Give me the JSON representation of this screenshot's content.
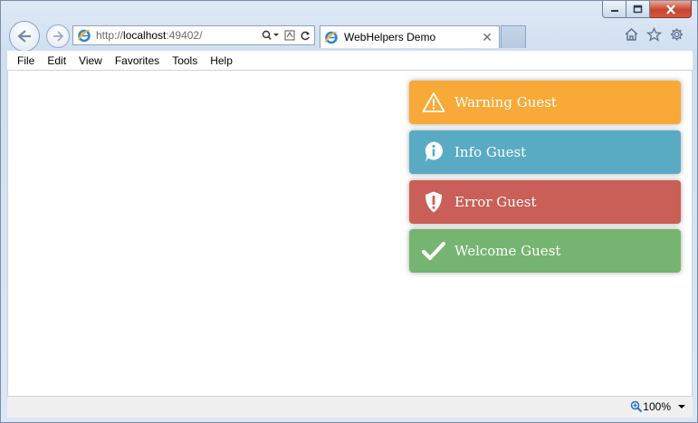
{
  "browser": {
    "url_prefix": "http://",
    "url_host": "localhost",
    "url_suffix": ":49402/",
    "tab_title": "WebHelpers Demo",
    "tab_close": "✕"
  },
  "menu": {
    "items": [
      "File",
      "Edit",
      "View",
      "Favorites",
      "Tools",
      "Help"
    ]
  },
  "toasts": [
    {
      "type": "warning",
      "text": "Warning Guest",
      "color": "#f9a938",
      "icon": "warning-triangle-icon"
    },
    {
      "type": "info",
      "text": "Info Guest",
      "color": "#59abc4",
      "icon": "info-bubble-icon"
    },
    {
      "type": "error",
      "text": "Error Guest",
      "color": "#c95f56",
      "icon": "shield-exclamation-icon"
    },
    {
      "type": "success",
      "text": "Welcome Guest",
      "color": "#76b571",
      "icon": "checkmark-icon"
    }
  ],
  "status": {
    "zoom": "100%"
  }
}
